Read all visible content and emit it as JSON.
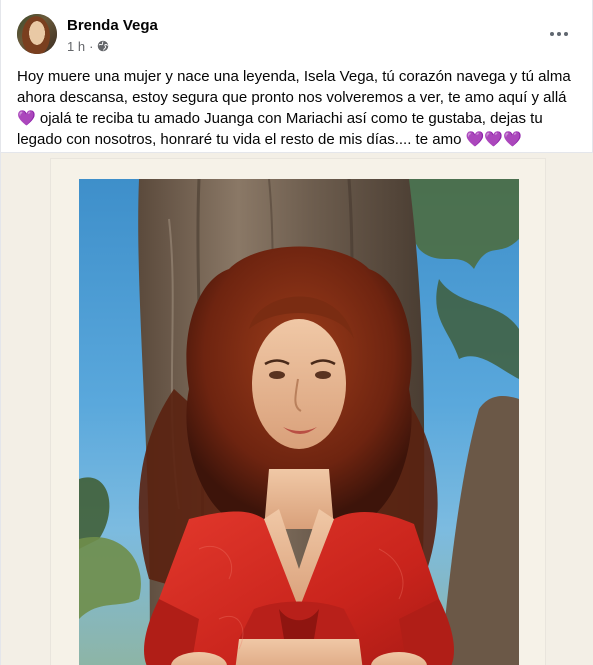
{
  "post": {
    "author_name": "Brenda Vega",
    "timestamp": "1 h",
    "separator": "·",
    "privacy_icon": "globe-icon",
    "more_icon": "more-horizontal-icon",
    "caption_main": "Hoy muere una mujer y nace una leyenda, Isela Vega, tú corazón navega y tú alma ahora descansa, estoy segura que pronto nos volveremos a ver, te amo aquí y allá ",
    "caption_heart_1": "💜",
    "caption_continue": " ojalá te reciba tu amado Juanga con Mariachi así como te gustaba, dejas tu legado con nosotros, honraré tu vida el resto de mis días.... te amo ",
    "caption_hearts_end": "💜💜💜"
  },
  "colors": {
    "text_primary": "#050505",
    "text_secondary": "#65676b",
    "divider": "#e4e6eb",
    "heart": "#9b30ff"
  }
}
